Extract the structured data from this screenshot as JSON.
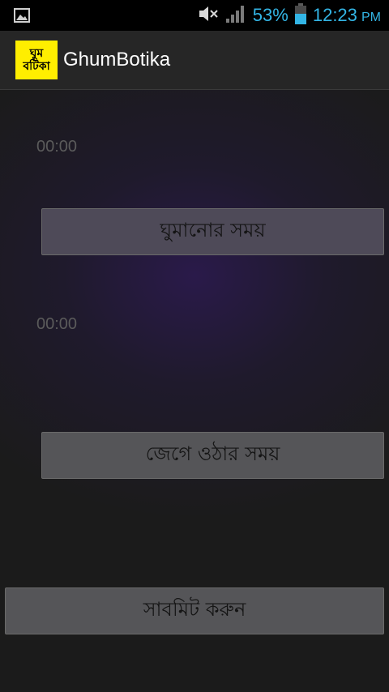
{
  "status_bar": {
    "battery_percent": "53%",
    "time": "12:23",
    "time_suffix": "PM",
    "icons": [
      "image-icon",
      "mute-icon",
      "signal-icon",
      "battery-icon"
    ],
    "accent_color": "#33b5e5"
  },
  "app_bar": {
    "logo_line1": "ঘুম",
    "logo_line2": "বটিকা",
    "title": "GhumBotika",
    "logo_color": "#ffee00"
  },
  "main": {
    "sleep_time": "00:00",
    "sleep_button_label": "ঘুমানোর সময়",
    "wake_time": "00:00",
    "wake_button_label": "জেগে  ওঠার সময়",
    "submit_button_label": "সাবমিট করুন"
  }
}
